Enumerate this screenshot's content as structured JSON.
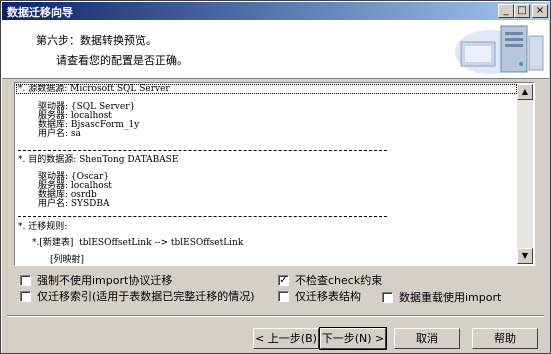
{
  "window": {
    "title": "数据迁移向导"
  },
  "titlebar_buttons": {
    "minimize": "_",
    "maximize": "□",
    "close": "×"
  },
  "header": {
    "step_title": "第六步：数据转换预览。",
    "step_subtitle": "请查看您的配置是否正确。"
  },
  "preview": {
    "source_heading": "*. 源数据源: Microsoft SQL Server",
    "source_fields": [
      "驱动器: {SQL Server}",
      "服务器: localhost",
      "数据库: BjsascForm_1y",
      "用户名: sa"
    ],
    "target_heading": "*. 目的数据源: ShenTong DATABASE",
    "target_fields": [
      "驱动器: {Oscar}",
      "服务器: localhost",
      "数据库: osrdb",
      "用户名: SYSDBA"
    ],
    "rules_heading": "*. 迁移规则:",
    "rules_item": "*.[新建表]  tblESOffsetLink --> tblESOffsetLink",
    "rules_mapping": "[列映射]",
    "separator": "----------------------------------------------------------------------------------------"
  },
  "options": {
    "force_no_import": {
      "label": "强制不使用import协议迁移",
      "checked": false
    },
    "no_check": {
      "label": "不检查check约束",
      "checked": true
    },
    "index_only": {
      "label": "仅迁移索引(适用于表数据已完整迁移的情况)",
      "checked": false
    },
    "structure_only": {
      "label": "仅迁移表结构",
      "checked": false
    },
    "reload_import": {
      "label": "数据重载使用import",
      "checked": false
    }
  },
  "buttons": {
    "back": "< 上一步(B)",
    "next": "下一步(N) >",
    "cancel": "取消",
    "help": "帮助"
  }
}
